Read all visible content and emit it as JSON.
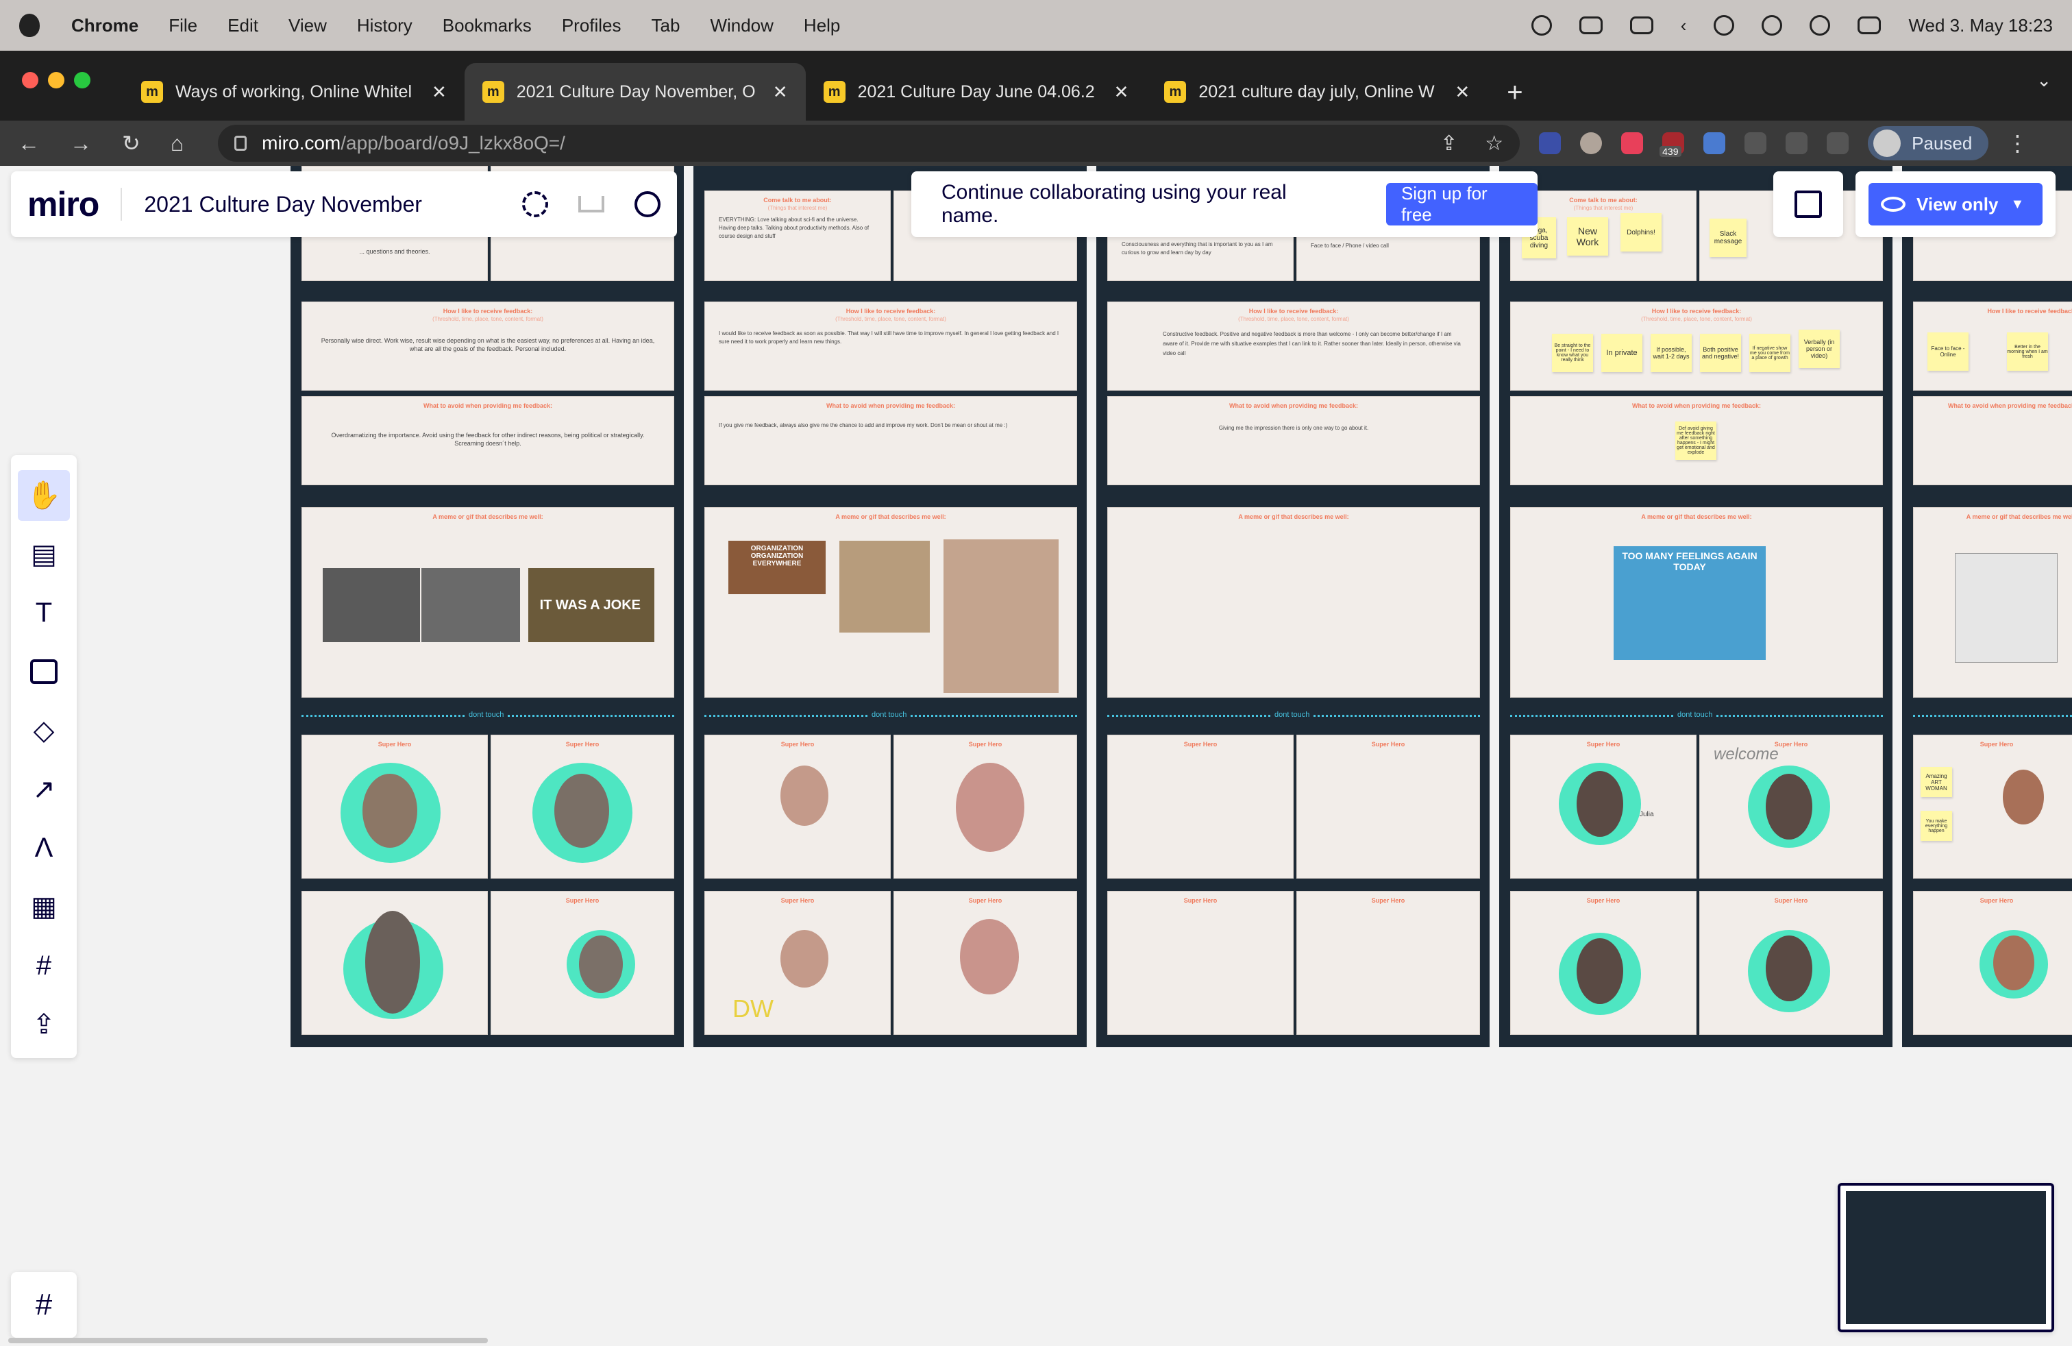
{
  "menubar": {
    "app": "Chrome",
    "items": [
      "File",
      "Edit",
      "View",
      "History",
      "Bookmarks",
      "Profiles",
      "Tab",
      "Window",
      "Help"
    ],
    "clock": "Wed 3. May  18:23"
  },
  "tabs": [
    {
      "title": "Ways of working, Online Whitel",
      "active": false
    },
    {
      "title": "2021 Culture Day November, O",
      "active": true
    },
    {
      "title": "2021 Culture Day June 04.06.2",
      "active": false
    },
    {
      "title": "2021 culture day july, Online W",
      "active": false
    }
  ],
  "address": {
    "host": "miro.com",
    "path": "/app/board/o9J_lzkx8oQ=/"
  },
  "profile": {
    "label": "Paused"
  },
  "extensions": {
    "badge": "439"
  },
  "miro": {
    "logo": "miro",
    "board_title": "2021 Culture Day November",
    "collab_message": "Continue collaborating using your real name.",
    "signup_label": "Sign up for free",
    "view_label": "View only"
  },
  "board": {
    "section_talk": "Come talk to me about:",
    "section_talk_sub": "(Things that interest me)",
    "section_feedback": "How I like to receive feedback:",
    "section_feedback_sub": "(Threshold, time, place, tone, content, format)",
    "section_avoid": "What to avoid when providing me feedback:",
    "section_meme": "A meme or gif that describes me well:",
    "divider": "dont touch",
    "hero": "Super Hero",
    "col1_feedback": "Personally wise direct. Work wise, result wise depending on what is the easiest way, no preferences at all. Having an idea, what are all the goals of the feedback. Personal included.",
    "col1_avoid": "Overdramatizing the importance. Avoid using the feedback for other indirect reasons, being political or strategically. Screaming doesn´t help.",
    "col1_talk": "... questions and theories.",
    "col2_talk": "EVERYTHING: Love talking about sci-fi and the universe. Having deep talks. Talking about productivity methods. Also of course design and stuff",
    "col2_feedback": "I would like to receive feedback as soon as possible. That way I will still have time to improve myself. In general I love getting feedback and I sure need it to work properly and learn new things.",
    "col2_avoid": "If you give me feedback, always also give me the chance to add and improve my work. Don't be mean or shout at me :)",
    "col3_talk": "Consciousness and everything that is important to you as I am curious to grow and learn day by day",
    "col3_talk2": "Face to face / Phone / video call",
    "col3_feedback": "Constructive feedback. Positive and negative feedback is more than welcome - I only can become better/change if I am aware of it. Provide me with situative examples that I can link to it. Rather sooner than later. Ideally in person, otherwise via video call",
    "col3_avoid": "Giving me the impression there is only one way to go about it.",
    "col4_stickies_talk": [
      "Yoga, scuba diving",
      "New Work",
      "Dolphins!",
      "Slack message"
    ],
    "col4_stickies_feedback": [
      "Be straight to the point - I need to know what you really think",
      "In private",
      "If possible, wait 1-2 days",
      "Both positive and negative!",
      "If negative show me you come from a place of growth",
      "Verbally (in person or video)"
    ],
    "col4_sticky_avoid": "Def avoid giving me feedback right after something happens - I might get emotional and explode",
    "col5_stickies": [
      "Face to face - Online",
      "Better in the morning when I am fresh",
      "Amazing ART WOMAN",
      "You make everything happen"
    ],
    "meme_captions": [
      "IT WAS A JOKE",
      "ORGANIZATION ORGANIZATION EVERYWHERE",
      "TOO MANY FEELINGS AGAIN TODAY"
    ],
    "doodle_text": [
      "welcome",
      "Julia",
      "DW"
    ]
  }
}
